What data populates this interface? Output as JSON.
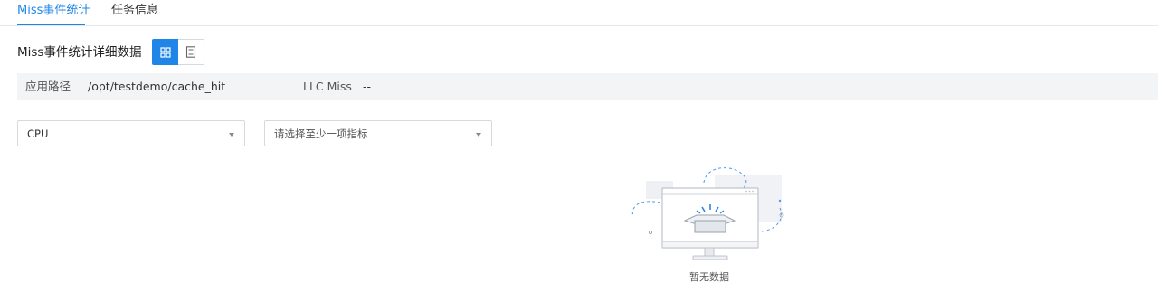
{
  "tabs": [
    {
      "label": "Miss事件统计",
      "active": true
    },
    {
      "label": "任务信息",
      "active": false
    }
  ],
  "section": {
    "title": "Miss事件统计详细数据",
    "view_modes": [
      {
        "icon": "grid-view-icon",
        "active": true
      },
      {
        "icon": "list-view-icon",
        "active": false
      }
    ]
  },
  "info": {
    "app_path_label": "应用路径",
    "app_path_value": "/opt/testdemo/cache_hit",
    "llc_miss_label": "LLC Miss",
    "llc_miss_value": "--"
  },
  "filters": {
    "cpu_select": {
      "value": "CPU"
    },
    "metric_select": {
      "placeholder": "请选择至少一项指标"
    }
  },
  "empty_state": {
    "text": "暂无数据",
    "icon": "empty-box-illustration"
  },
  "colors": {
    "accent": "#1f86e8",
    "info_bar_bg": "#f3f4f6",
    "border": "#d5d9e0"
  }
}
